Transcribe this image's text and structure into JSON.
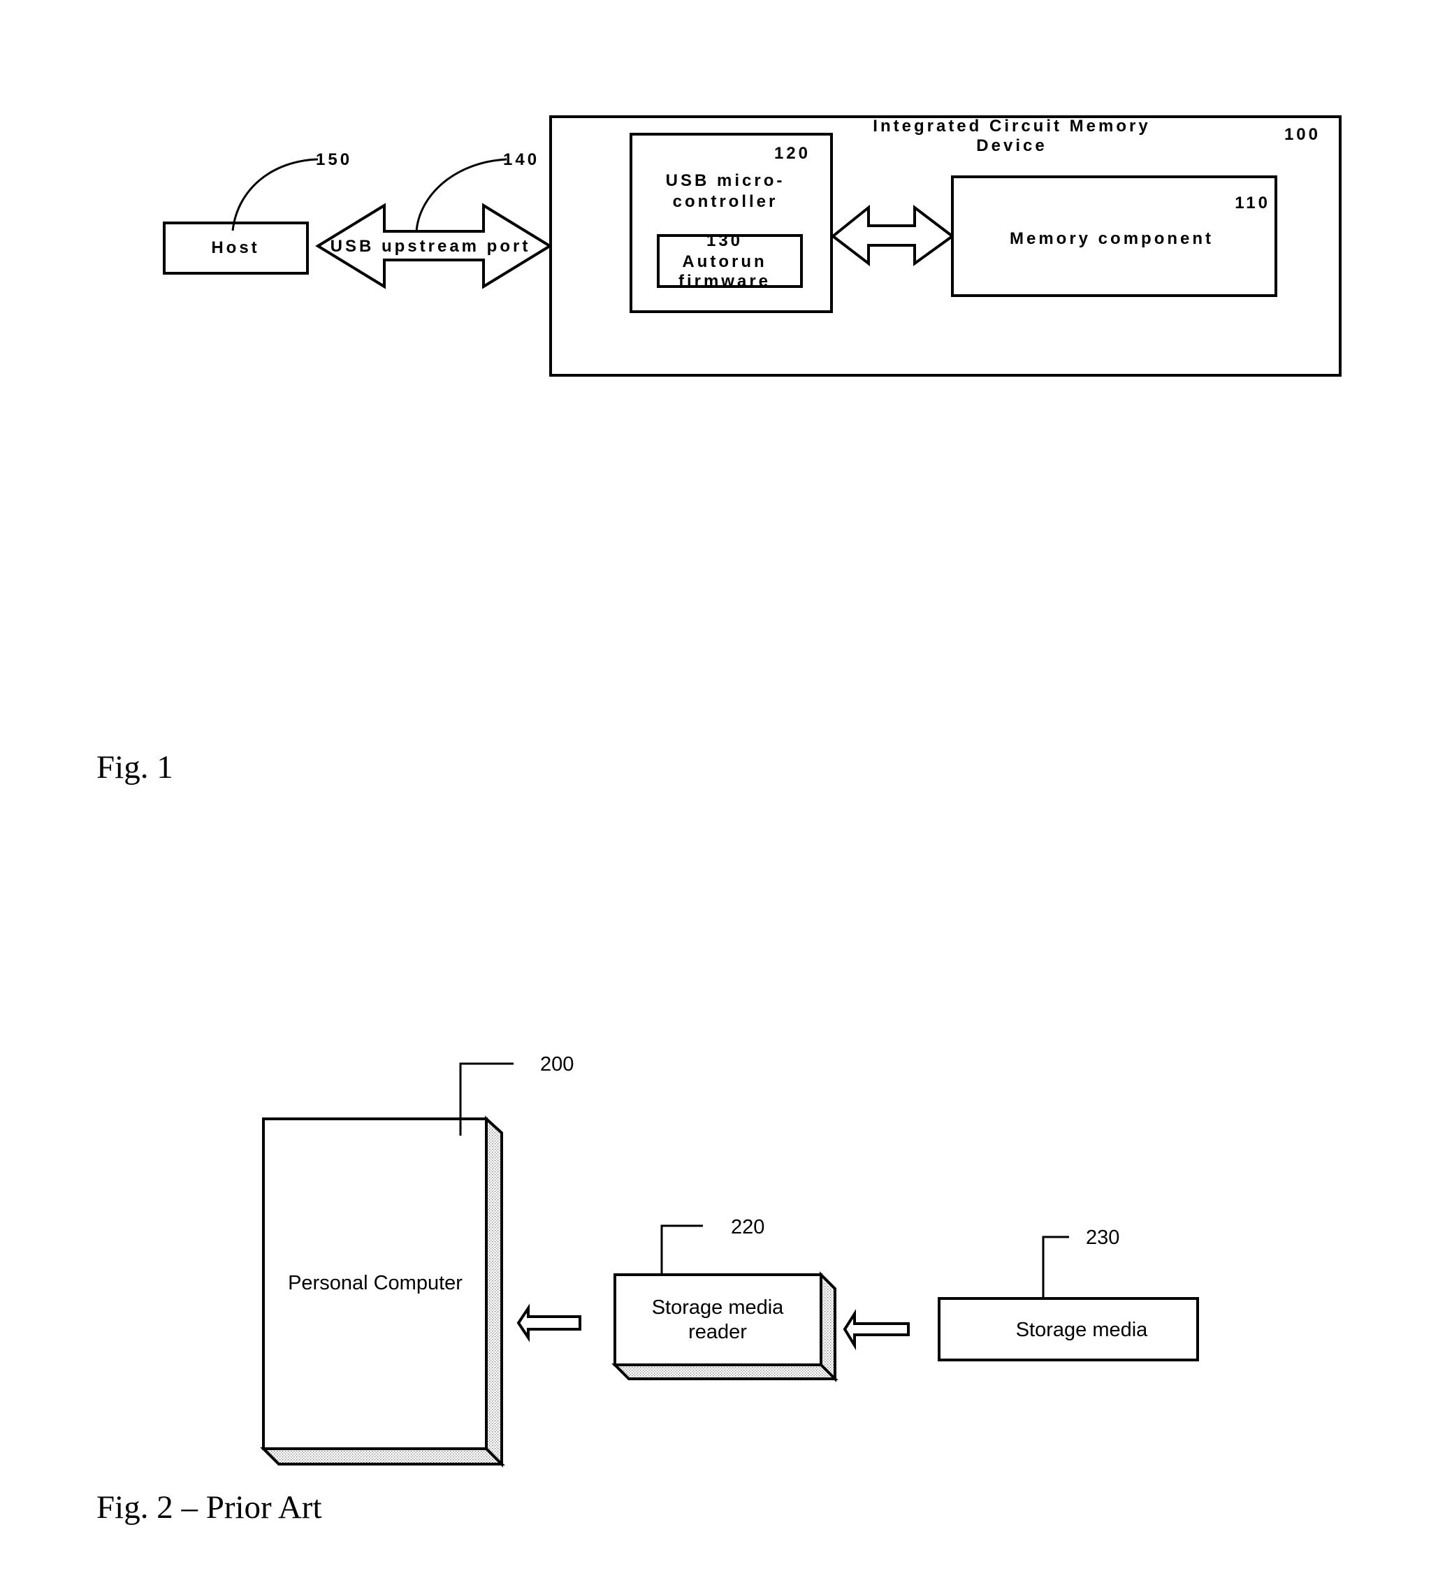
{
  "figure1": {
    "caption": "Fig. 1",
    "host": {
      "label": "Host",
      "ref": "150"
    },
    "usb_port": {
      "label": "USB upstream port",
      "ref": "140"
    },
    "device": {
      "title_line1": "Integrated Circuit Memory",
      "title_line2": "Device",
      "ref": "100"
    },
    "microcontroller": {
      "label_line1": "USB micro-",
      "label_line2": "controller",
      "ref": "120"
    },
    "firmware": {
      "ref": "130",
      "label_line1": "Autorun",
      "label_line2": "firmware"
    },
    "memory": {
      "label": "Memory component",
      "ref": "110"
    }
  },
  "figure2": {
    "caption": "Fig. 2 – Prior Art",
    "computer": {
      "label": "Personal Computer",
      "ref": "200"
    },
    "reader": {
      "label_line1": "Storage media",
      "label_line2": "reader",
      "ref": "220"
    },
    "media": {
      "label": "Storage media",
      "ref": "230"
    }
  }
}
